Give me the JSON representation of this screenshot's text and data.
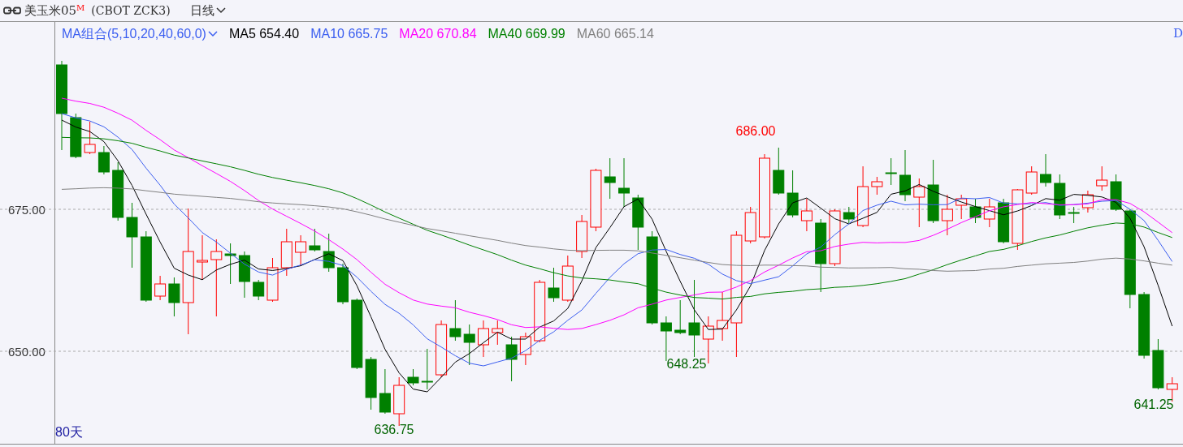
{
  "header": {
    "title": "美玉米05$^{M}$",
    "code": "(CBOT ZCK3)",
    "period": "日线"
  },
  "legend": {
    "combo": "MA组合(5,10,20,40,60,0)",
    "items": [
      {
        "label": "MA5 654.40",
        "color": "#000000"
      },
      {
        "label": "MA10 665.75",
        "color": "#3b5ef0"
      },
      {
        "label": "MA20 670.84",
        "color": "#ff00ff"
      },
      {
        "label": "MA40 669.99",
        "color": "#008000"
      },
      {
        "label": "MA60 665.14",
        "color": "#808080"
      }
    ],
    "edge": "D"
  },
  "y_axis": {
    "labels": [
      "675.00",
      "650.00"
    ]
  },
  "annotations": [
    {
      "text": "686.00",
      "kind": "high"
    },
    {
      "text": "648.25",
      "kind": "low"
    },
    {
      "text": "636.75",
      "kind": "low"
    },
    {
      "text": "641.25",
      "kind": "low"
    }
  ],
  "footer": {
    "range": "80天"
  }
}
